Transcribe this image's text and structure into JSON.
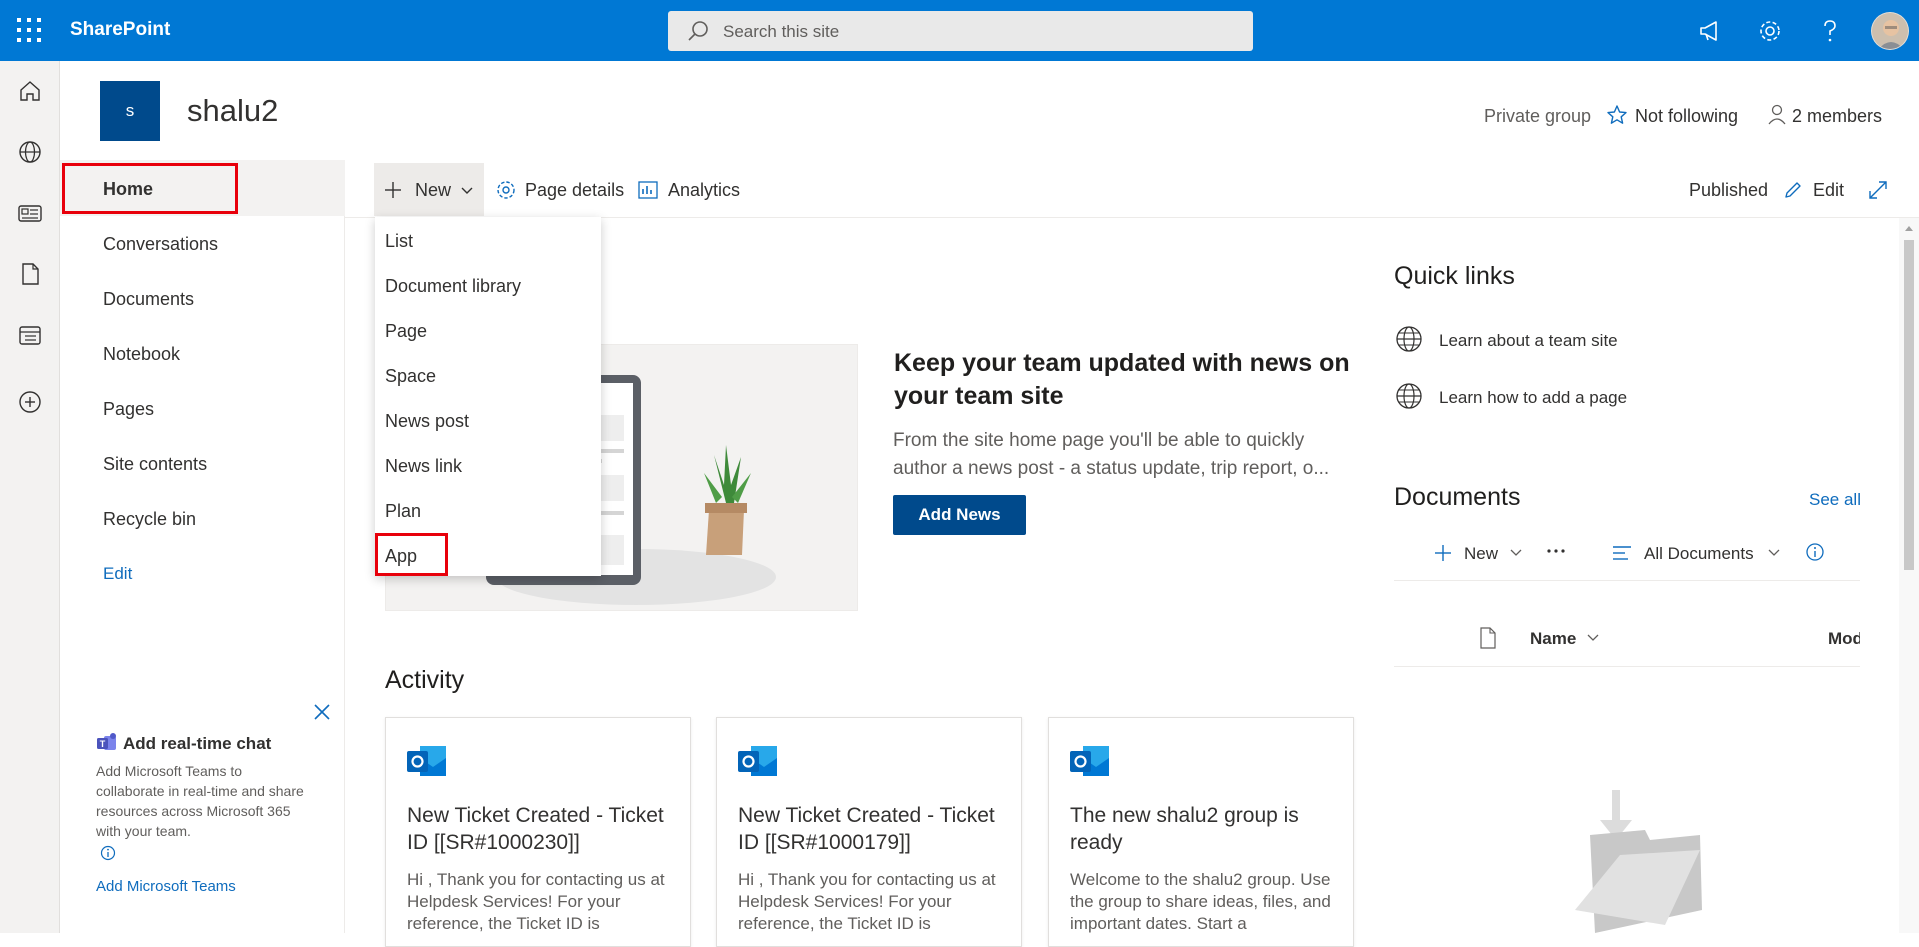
{
  "suite": {
    "brand": "SharePoint",
    "search_placeholder": "Search this site"
  },
  "site": {
    "logo_letter": "s",
    "title": "shalu2",
    "privacy": "Private group",
    "follow_label": "Not following",
    "members_label": "2 members"
  },
  "nav": {
    "items": [
      "Home",
      "Conversations",
      "Documents",
      "Notebook",
      "Pages",
      "Site contents",
      "Recycle bin"
    ],
    "edit_label": "Edit"
  },
  "cmdbar": {
    "new_label": "New",
    "page_details_label": "Page details",
    "analytics_label": "Analytics",
    "status": "Published",
    "edit_label": "Edit"
  },
  "new_menu": {
    "items": [
      "List",
      "Document library",
      "Page",
      "Space",
      "News post",
      "News link",
      "Plan",
      "App"
    ]
  },
  "news": {
    "title": "Keep your team updated with news on your team site",
    "body": "From the site home page you'll be able to quickly author a news post - a status update, trip report, o...",
    "button": "Add News"
  },
  "activity": {
    "title": "Activity",
    "cards": [
      {
        "title": "New Ticket Created - Ticket ID [[SR#1000230]]",
        "body": "Hi , Thank you for contacting us at Helpdesk Services! For your reference, the Ticket ID is"
      },
      {
        "title": "New Ticket Created - Ticket ID [[SR#1000179]]",
        "body": "Hi , Thank you for contacting us at Helpdesk Services! For your reference, the Ticket ID is"
      },
      {
        "title": "The new shalu2 group is ready",
        "body": "Welcome to the shalu2 group. Use the group to share ideas, files, and important dates. Start a"
      }
    ]
  },
  "teams_promo": {
    "title": "Add real-time chat",
    "body": "Add Microsoft Teams to collaborate in real-time and share resources across Microsoft 365 with your team.",
    "link": "Add Microsoft Teams"
  },
  "quick_links": {
    "title": "Quick links",
    "items": [
      "Learn about a team site",
      "Learn how to add a page"
    ]
  },
  "documents": {
    "title": "Documents",
    "see_all": "See all",
    "new_label": "New",
    "view_label": "All Documents",
    "col_name": "Name",
    "col_modified": "Mod"
  },
  "colors": {
    "suite": "#0078d4",
    "accent": "#004a8c",
    "highlight": "#e8000b",
    "link": "#0f6cbd"
  }
}
